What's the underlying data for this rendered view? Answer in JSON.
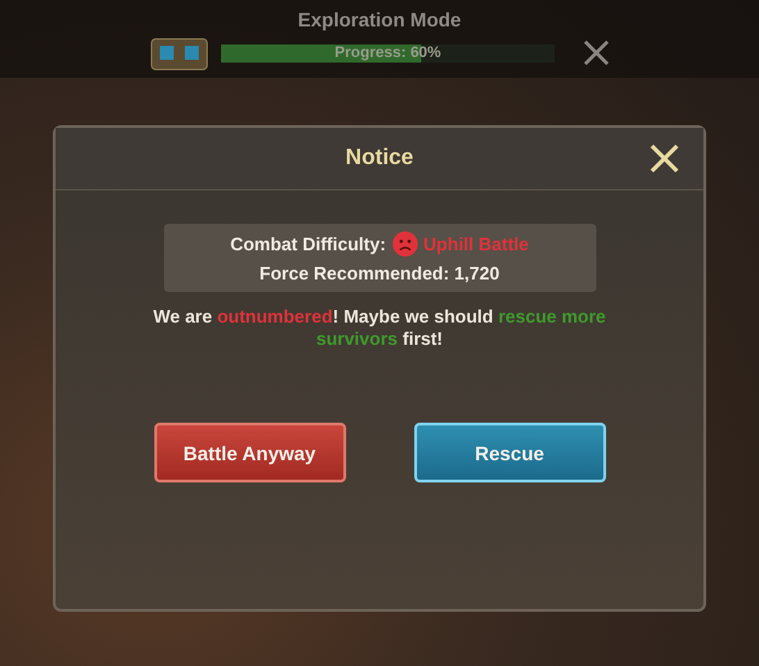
{
  "hud": {
    "title": "Exploration Mode",
    "progress": {
      "label": "Progress: 60%",
      "level": 0.6
    }
  },
  "dialog": {
    "title": "Notice",
    "info": {
      "difficulty": {
        "label": "Combat Difficulty:",
        "value": "Uphill Battle",
        "color": "#e0323a"
      },
      "force": "Force Recommended: 1,720"
    },
    "message": [
      {
        "text": "We are ",
        "color": "#ece6dc"
      },
      {
        "text": "outnumbered",
        "color": "#e0323a"
      },
      {
        "text": "! Maybe we should ",
        "color": "#ece6dc"
      },
      {
        "text": "rescue more survivors",
        "color": "#3f9a2c"
      },
      {
        "text": " first!",
        "color": "#ece6dc"
      }
    ],
    "buttons": [
      {
        "label": "Battle Anyway",
        "kind": "danger"
      },
      {
        "label": "Rescue",
        "kind": "primary"
      }
    ]
  }
}
